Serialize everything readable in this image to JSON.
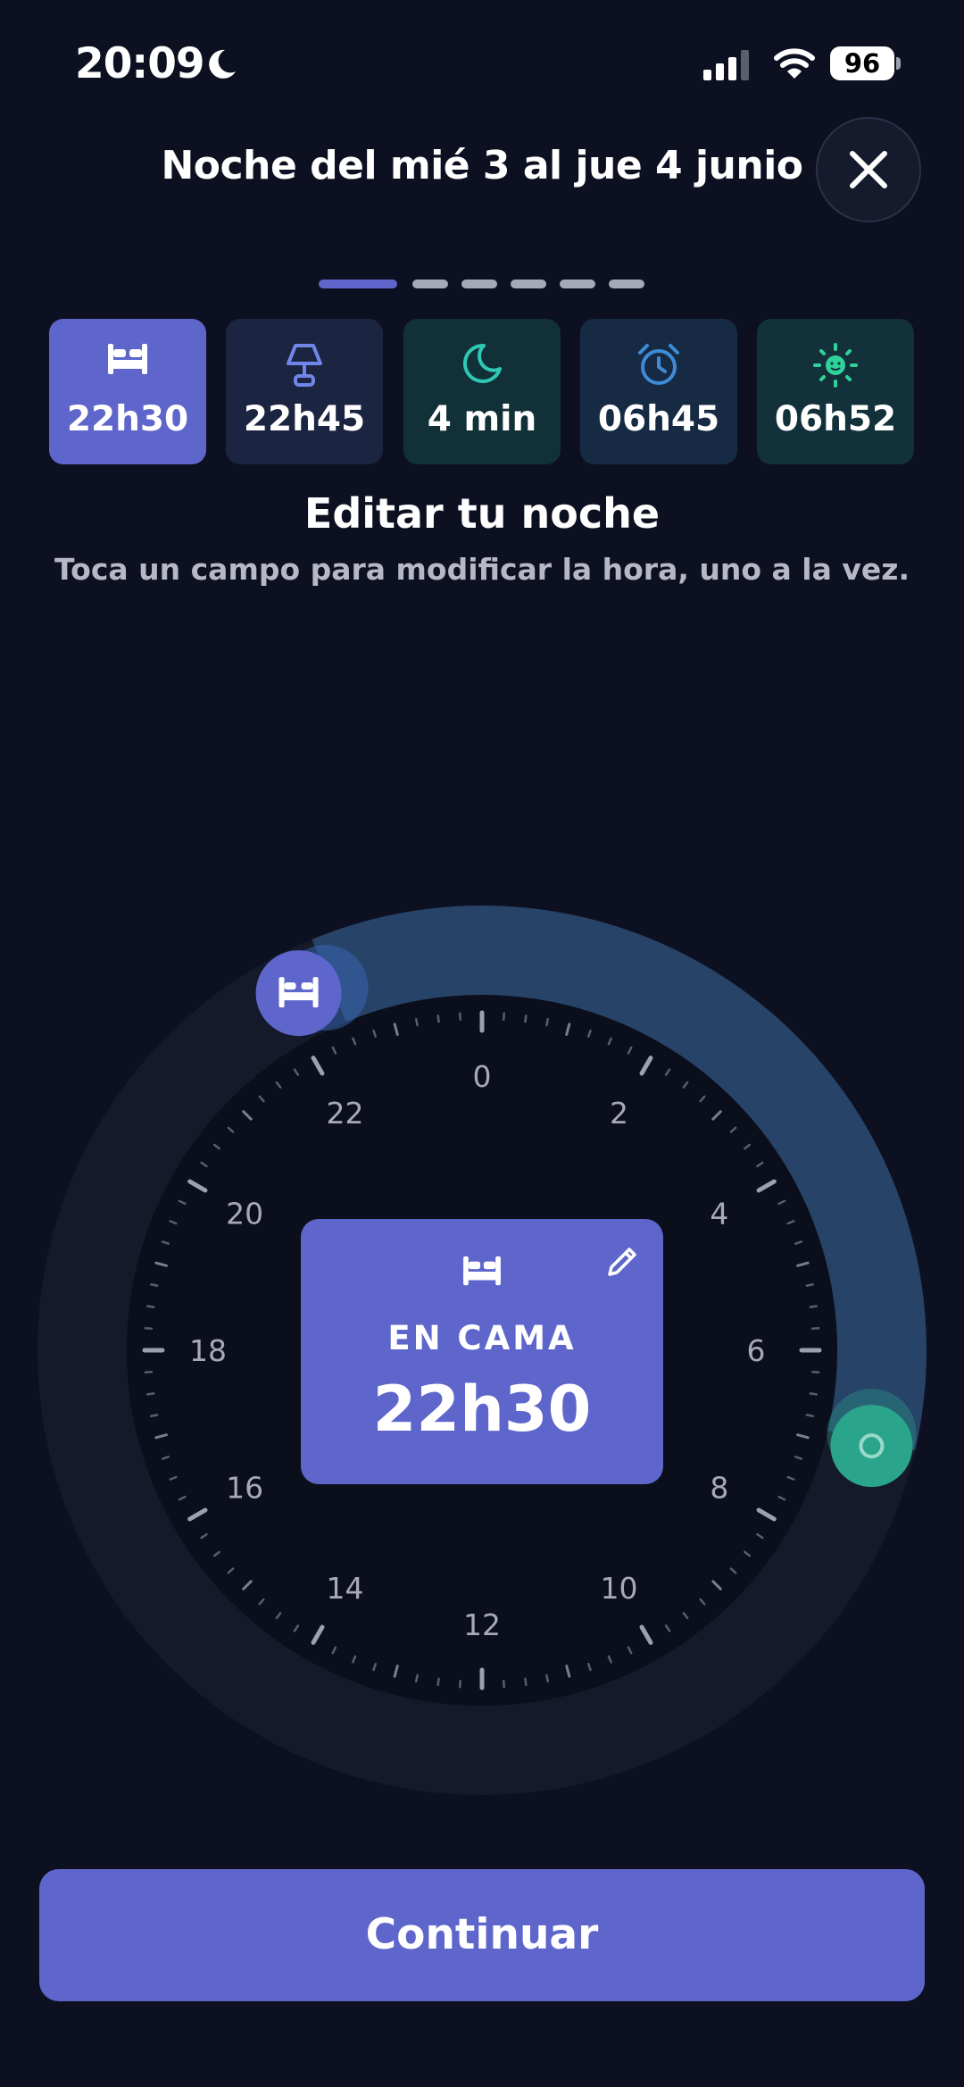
{
  "status": {
    "time": "20:09",
    "battery": "96"
  },
  "header": {
    "title": "Noche del mié 3 al jue 4 junio"
  },
  "progress": {
    "steps": 6,
    "current": 1
  },
  "cards": [
    {
      "name": "bed",
      "icon": "bed-icon",
      "value": "22h30",
      "bg": "#5e66cb",
      "color": "#ffffff"
    },
    {
      "name": "lamp",
      "icon": "lamp-icon",
      "value": "22h45",
      "bg": "#1b2440",
      "color": "#6f86e8"
    },
    {
      "name": "sleep",
      "icon": "moon-icon",
      "value": "4 min",
      "bg": "#123038",
      "color": "#2ec9b3"
    },
    {
      "name": "alarm",
      "icon": "alarm-icon",
      "value": "06h45",
      "bg": "#172a44",
      "color": "#3e8bd6"
    },
    {
      "name": "wake",
      "icon": "sun-icon",
      "value": "06h52",
      "bg": "#12313a",
      "color": "#2fd29a"
    }
  ],
  "edit": {
    "title": "Editar tu noche",
    "subtitle": "Toca un campo para modificar la hora, uno a la vez."
  },
  "dial": {
    "hour_labels": [
      "0",
      "2",
      "4",
      "6",
      "8",
      "10",
      "12",
      "14",
      "16",
      "18",
      "20",
      "22"
    ],
    "bed_hour": 22.5,
    "wake_hour": 6.87
  },
  "center": {
    "label": "EN CAMA",
    "time": "22h30"
  },
  "continue_label": "Continuar",
  "colors": {
    "accent": "#5e66cb",
    "background": "#0d1020",
    "arc": "#2a4b72",
    "wake": "#2aa58c"
  }
}
